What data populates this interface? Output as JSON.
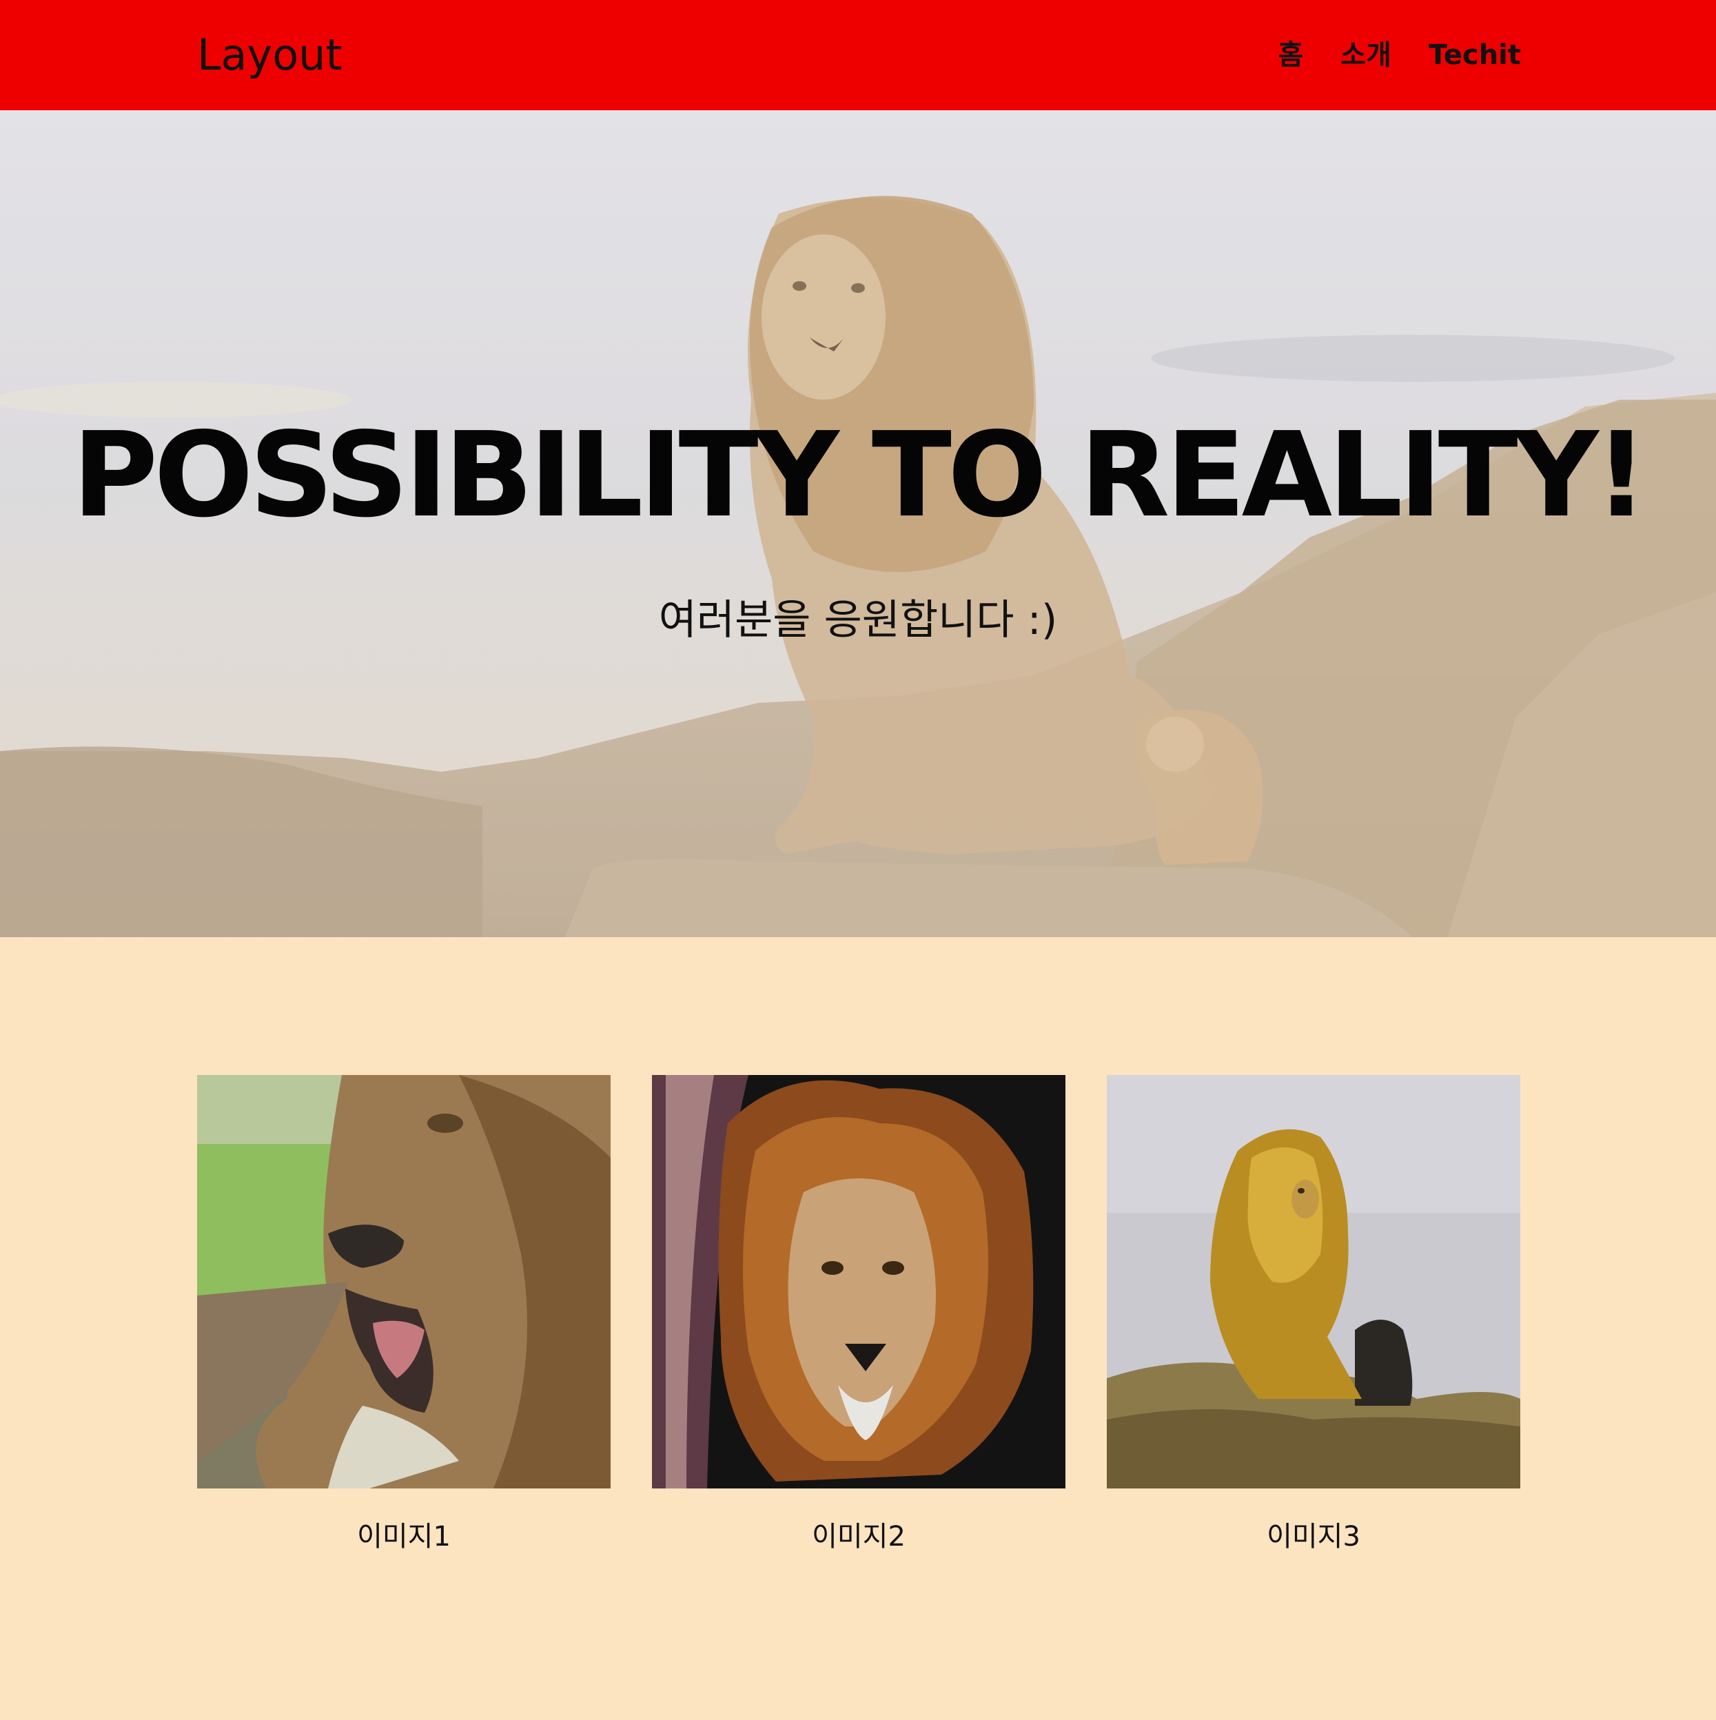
{
  "header": {
    "brand": "Layout",
    "nav": [
      "홈",
      "소개",
      "Techit"
    ],
    "background_color": "#ee0000"
  },
  "hero": {
    "title": "POSSIBILITY TO REALITY!",
    "subtitle": "여러분을 응원합니다 :)"
  },
  "gallery": {
    "items": [
      {
        "caption": "이미지1",
        "image": "lion-photo-1"
      },
      {
        "caption": "이미지2",
        "image": "lion-photo-2"
      },
      {
        "caption": "이미지3",
        "image": "lion-photo-3"
      }
    ]
  },
  "colors": {
    "page_background": "#fce4c1",
    "header": "#ee0000"
  }
}
